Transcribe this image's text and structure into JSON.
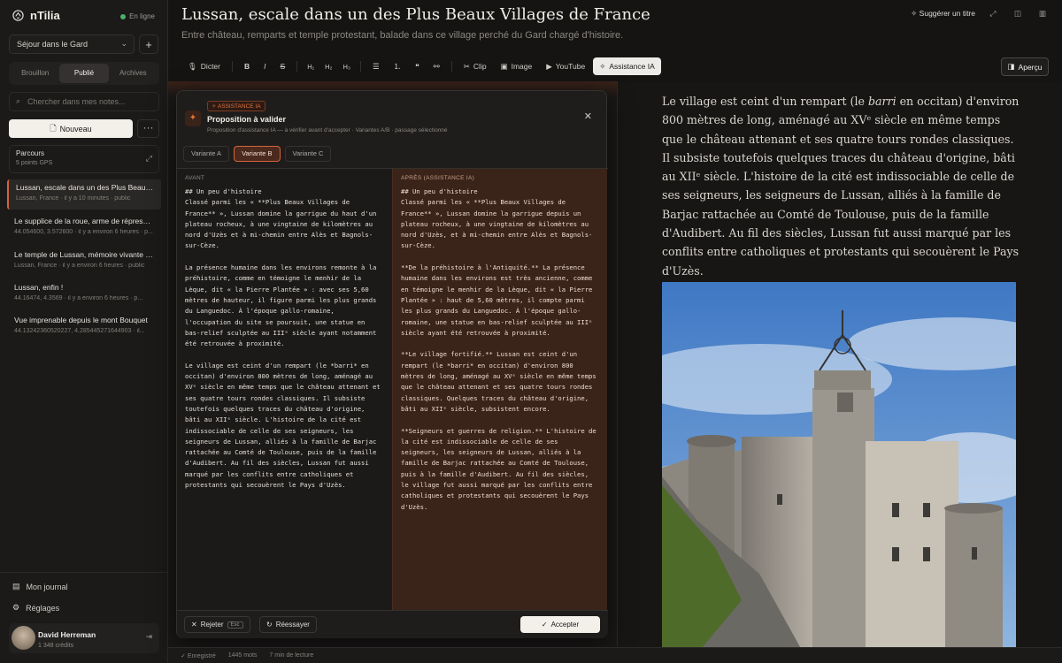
{
  "app": {
    "name": "nTilia",
    "status": "En ligne"
  },
  "sidebar": {
    "project": "Séjour dans le Gard",
    "tabs": [
      {
        "label": "Brouillon"
      },
      {
        "label": "Publié"
      },
      {
        "label": "Archives"
      }
    ],
    "search_placeholder": "Chercher dans mes notes...",
    "new_label": "Nouveau",
    "more_label": "···",
    "route": {
      "title": "Parcours",
      "subtitle": "5 points GPS"
    },
    "notes": [
      {
        "title": "Lussan, escale dans un des Plus Beaux ...",
        "meta": "Lussan, France · il y a 10 minutes · public"
      },
      {
        "title": "Le supplice de la roue, arme de répressi...",
        "meta": "44.054600, 3.572600 · il y a environ 6 heures · p..."
      },
      {
        "title": "Le temple de Lussan, mémoire vivante d...",
        "meta": "Lussan, France · il y a environ 6 heures · public"
      },
      {
        "title": "Lussan, enfin !",
        "meta": "44.16474, 4.3569 · il y a environ 6 heures · p..."
      },
      {
        "title": "Vue imprenable depuis le mont Bouquet",
        "meta": "44.13242360520227, 4.285445271644903 · il..."
      }
    ],
    "footer_links": [
      {
        "label": "Mon journal"
      },
      {
        "label": "Réglages"
      }
    ],
    "user": {
      "name": "David Herreman",
      "credits": "1 348 crédits"
    }
  },
  "header": {
    "title": "Lussan, escale dans un des Plus Beaux Villages de France",
    "subtitle": "Entre château, remparts et temple protestant, balade dans ce village perché du Gard chargé d'histoire.",
    "suggest_title": "Suggérer un titre"
  },
  "toolbar": {
    "dictate": "Dicter",
    "bold": "B",
    "italic": "I",
    "strike": "S",
    "h1": "H₁",
    "h2": "H₂",
    "h3": "H₃",
    "clip": "Clip",
    "image": "Image",
    "youtube": "YouTube",
    "ai_assist": "Assistance IA",
    "preview": "Aperçu"
  },
  "modal": {
    "badge": "ASSISTANCE IA",
    "title": "Proposition à valider",
    "subtitle": "Proposition d'assistance IA — à vérifier avant d'accepter · Variantes A/B · passage sélectionné",
    "variants": [
      {
        "label": "Variante A"
      },
      {
        "label": "Variante B"
      },
      {
        "label": "Variante C"
      }
    ],
    "before_label": "AVANT",
    "after_label": "APRÈS (ASSISTANCE IA)",
    "before_text": "## Un peu d'histoire\nClassé parmi les « **Plus Beaux Villages de France** », Lussan domine la garrigue du haut d'un plateau rocheux, à une vingtaine de kilomètres au nord d'Uzès et à mi-chemin entre Alès et Bagnols-sur-Cèze.\n\nLa présence humaine dans les environs remonte à la préhistoire, comme en témoigne le menhir de la Lèque, dit « la Pierre Plantée » : avec ses 5,60 mètres de hauteur, il figure parmi les plus grands du Languedoc. À l'époque gallo-romaine, l'occupation du site se poursuit, une statue en bas-relief sculptée au IIIᵉ siècle ayant notamment été retrouvée à proximité.\n\nLe village est ceint d'un rempart (le *barri* en occitan) d'environ 800 mètres de long, aménagé au XVᵉ siècle en même temps que le château attenant et ses quatre tours rondes classiques. Il subsiste toutefois quelques traces du château d'origine, bâti au XIIᵉ siècle. L'histoire de la cité est indissociable de celle de ses seigneurs, les seigneurs de Lussan, alliés à la famille de Barjac rattachée au Comté de Toulouse, puis de la famille d'Audibert. Au fil des siècles, Lussan fut aussi marqué par les conflits entre catholiques et protestants qui secouèrent le Pays d'Uzès.",
    "after_text": "## Un peu d'histoire\nClassé parmi les « **Plus Beaux Villages de France** », Lussan domine la garrigue depuis un plateau rocheux, à une vingtaine de kilomètres au nord d'Uzès, et à mi-chemin entre Alès et Bagnols-sur-Cèze.\n\n**De la préhistoire à l'Antiquité.** La présence humaine dans les environs est très ancienne, comme en témoigne le menhir de la Lèque, dit « la Pierre Plantée » : haut de 5,60 mètres, il compte parmi les plus grands du Languedoc. À l'époque gallo-romaine, une statue en bas-relief sculptée au IIIᵉ siècle ayant été retrouvée à proximité.\n\n**Le village fortifié.** Lussan est ceint d'un rempart (le *barri* en occitan) d'environ 800 mètres de long, aménagé au XVᵉ siècle en même temps que le château attenant et ses quatre tours rondes classiques. Quelques traces du château d'origine, bâti au XIIᵉ siècle, subsistent encore.\n\n**Seigneurs et guerres de religion.** L'histoire de la cité est indissociable de celle de ses seigneurs, les seigneurs de Lussan, alliés à la famille de Barjac rattachée au Comté de Toulouse, puis à la famille d'Audibert. Au fil des siècles, le village fut aussi marqué par les conflits entre catholiques et protestants qui secouèrent le Pays d'Uzès.",
    "reject": "Rejeter",
    "reject_kbd": "Esc",
    "retry": "Réessayer",
    "accept": "Accepter"
  },
  "preview": {
    "text_1": "Le village est ceint d'un rempart (le ",
    "text_italic": "barri",
    "text_2": " en occitan) d'environ 800 mètres de long, aménagé au XVᵉ siècle en même temps que le château attenant et ses quatre tours rondes classiques. Il subsiste toutefois quelques traces du château d'origine, bâti au XIIᵉ siècle. L'histoire de la cité est indissociable de celle de ses seigneurs, les seigneurs de Lussan, alliés à la famille de Barjac rattachée au Comté de Toulouse, puis de la famille d'Audibert. Au fil des siècles, Lussan fut aussi marqué par les conflits entre catholiques et protestants qui secouèrent le Pays d'Uzès."
  },
  "statusbar": {
    "saved": "Enregistré",
    "words": "1445 mots",
    "reading": "7 min de lecture"
  }
}
